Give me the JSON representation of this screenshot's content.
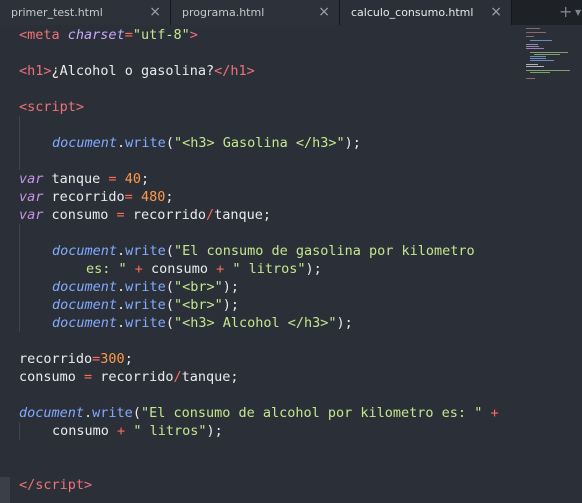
{
  "tabs": [
    {
      "label": "primer_test.html",
      "close": "×"
    },
    {
      "label": "programa.html",
      "close": "×"
    },
    {
      "label": "calculo_consumo.html",
      "close": "×"
    }
  ],
  "tab_actions": {
    "new_tab": "+",
    "more": "▼"
  },
  "code": {
    "l1": {
      "lt": "<",
      "tag": "meta",
      "attr": "charset",
      "eq": "=",
      "val": "\"utf-8\"",
      "gt": ">"
    },
    "l3": {
      "lt": "<",
      "tag": "h1",
      "gt": ">",
      "text": "¿Alcohol o gasolina?",
      "lt2": "</",
      "tag2": "h1",
      "gt2": ">"
    },
    "l5": {
      "lt": "<",
      "tag": "script",
      "gt": ">"
    },
    "l7": {
      "obj": "document",
      "dot": ".",
      "fn": "write",
      "p1": "(",
      "str": "\"<h3> Gasolina </h3>\"",
      "p2": ");"
    },
    "l9": {
      "kw": "var",
      "name": " tanque ",
      "op": "=",
      "sp": " ",
      "num": "40",
      "semi": ";"
    },
    "l10": {
      "kw": "var",
      "name": " recorrido",
      "op": "=",
      "sp": " ",
      "num": "480",
      "semi": ";"
    },
    "l11": {
      "kw": "var",
      "name": " consumo ",
      "op": "=",
      "rest1": " recorrido",
      "op2": "/",
      "rest2": "tanque;"
    },
    "l13": {
      "obj": "document",
      "dot": ".",
      "fn": "write",
      "p1": "(",
      "str": "\"El consumo de gasolina por kilometro"
    },
    "l14": {
      "str": "es: \"",
      "sp1": " ",
      "op": "+",
      "mid": " consumo ",
      "op2": "+",
      "sp2": " ",
      "str2": "\" litros\"",
      "end": ");"
    },
    "l15": {
      "obj": "document",
      "dot": ".",
      "fn": "write",
      "p1": "(",
      "str": "\"<br>\"",
      "p2": ");"
    },
    "l16": {
      "obj": "document",
      "dot": ".",
      "fn": "write",
      "p1": "(",
      "str": "\"<br>\"",
      "p2": ");"
    },
    "l17": {
      "obj": "document",
      "dot": ".",
      "fn": "write",
      "p1": "(",
      "str": "\"<h3> Alcohol </h3>\"",
      "p2": ");"
    },
    "l19": {
      "name": "recorrido",
      "op": "=",
      "num": "300",
      "semi": ";"
    },
    "l20": {
      "name": "consumo ",
      "op": "=",
      "rest1": " recorrido",
      "op2": "/",
      "rest2": "tanque;"
    },
    "l22": {
      "obj": "document",
      "dot": ".",
      "fn": "write",
      "p1": "(",
      "str": "\"El consumo de alcohol por kilometro es: \"",
      "sp": " ",
      "op": "+"
    },
    "l23": {
      "name": "consumo ",
      "op": "+",
      "sp": " ",
      "str": "\" litros\"",
      "end": ");"
    },
    "l26": {
      "lt": "</",
      "tag": "script",
      "gt": ">"
    }
  },
  "colors": {
    "background": "#2b3038",
    "tag": "#f07178",
    "string": "#c3e88d",
    "number": "#ff9a4a",
    "keyword": "#c792ea",
    "function": "#82aaff",
    "operator": "#ff6a5c"
  },
  "icons": {
    "close": "close-icon",
    "new_tab": "plus-icon",
    "more": "chevron-down-icon"
  }
}
